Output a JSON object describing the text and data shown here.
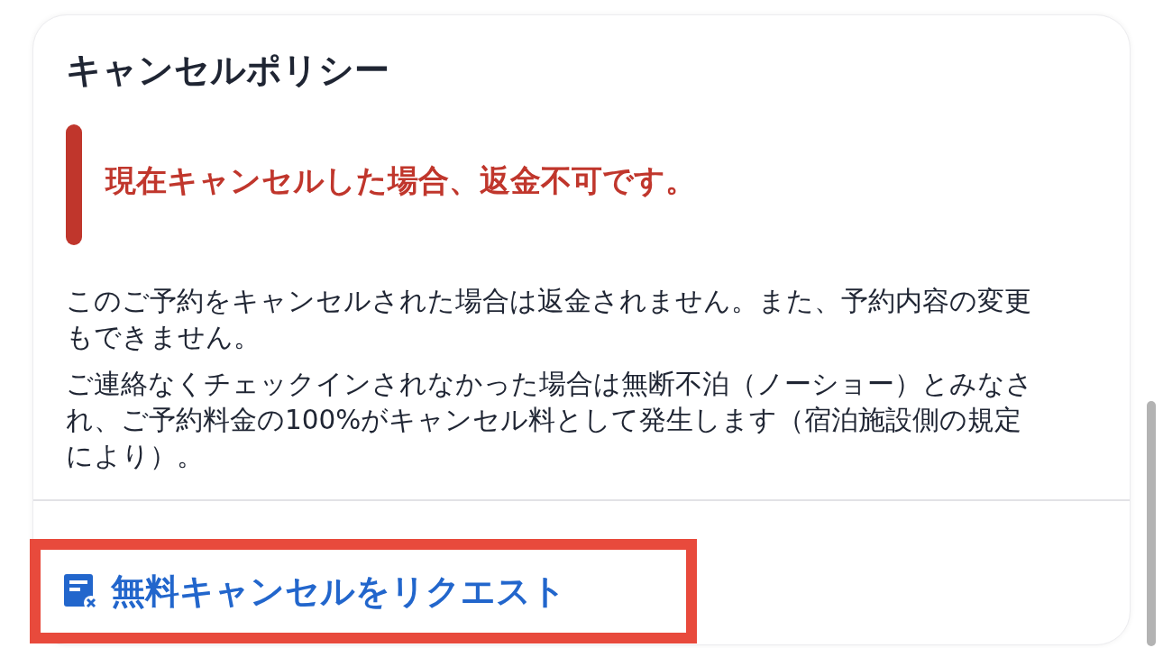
{
  "card": {
    "title": "キャンセルポリシー",
    "alert": "現在キャンセルした場合、返金不可です。",
    "paragraphs": [
      "このご予約をキャンセルされた場合は返金されません。また、予約内容の変更もできません。",
      "ご連絡なくチェックインされなかった場合は無断不泊（ノーショー）とみなされ、ご予約料金の100%がキャンセル料として発生します（宿泊施設側の規定により）。"
    ],
    "action": {
      "label": "無料キャンセルをリクエスト",
      "highlighted": true
    }
  }
}
